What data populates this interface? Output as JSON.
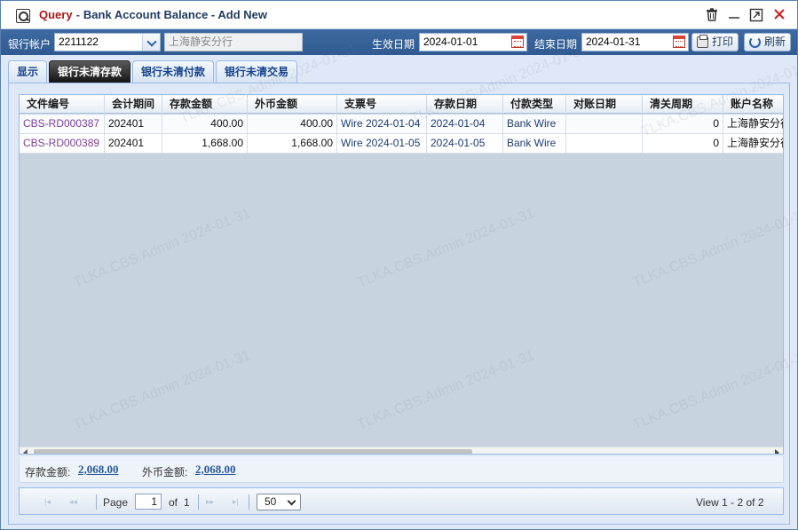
{
  "window": {
    "title_prefix": "Query",
    "title_sep": "-",
    "title": "Bank Account Balance - Add New",
    "controls": {
      "delete_icon": "trash-icon",
      "minimize_icon": "minimize-icon",
      "maximize_icon": "maximize-icon",
      "close_icon": "close-icon"
    }
  },
  "toolbar": {
    "bank_account_label": "银行帐户",
    "bank_account_value": "2211122",
    "bank_name_value": "上海静安分行",
    "effective_date_label": "生效日期",
    "effective_date_value": "2024-01-01",
    "end_date_label": "结束日期",
    "end_date_value": "2024-01-31",
    "print_label": "打印",
    "refresh_label": "刷新"
  },
  "tabs": [
    {
      "label": "显示",
      "active": false
    },
    {
      "label": "银行未清存款",
      "active": true
    },
    {
      "label": "银行未清付款",
      "active": false
    },
    {
      "label": "银行未清交易",
      "active": false
    }
  ],
  "grid": {
    "columns": [
      "文件编号",
      "会计期间",
      "存款金额",
      "外币金额",
      "支票号",
      "存款日期",
      "付款类型",
      "对账日期",
      "清关周期",
      "账户名称"
    ],
    "rows": [
      [
        "CBS-RD000387",
        "202401",
        "400.00",
        "400.00",
        "Wire 2024-01-04",
        "2024-01-04",
        "Bank Wire",
        "",
        "0",
        "上海静安分行"
      ],
      [
        "CBS-RD000389",
        "202401",
        "1,668.00",
        "1,668.00",
        "Wire 2024-01-05",
        "2024-01-05",
        "Bank Wire",
        "",
        "0",
        "上海静安分行"
      ]
    ]
  },
  "summary": {
    "deposit_label": "存款金额:",
    "deposit_value": "2,068.00",
    "foreign_label": "外币金额:",
    "foreign_value": "2,068.00"
  },
  "pager": {
    "page_label": "Page",
    "page_value": "1",
    "of_label": "of",
    "total_pages": "1",
    "page_size": "50",
    "view_text": "View 1 - 2 of 2"
  },
  "watermark": "TLKA.CBS.Admin 2024-01-31"
}
